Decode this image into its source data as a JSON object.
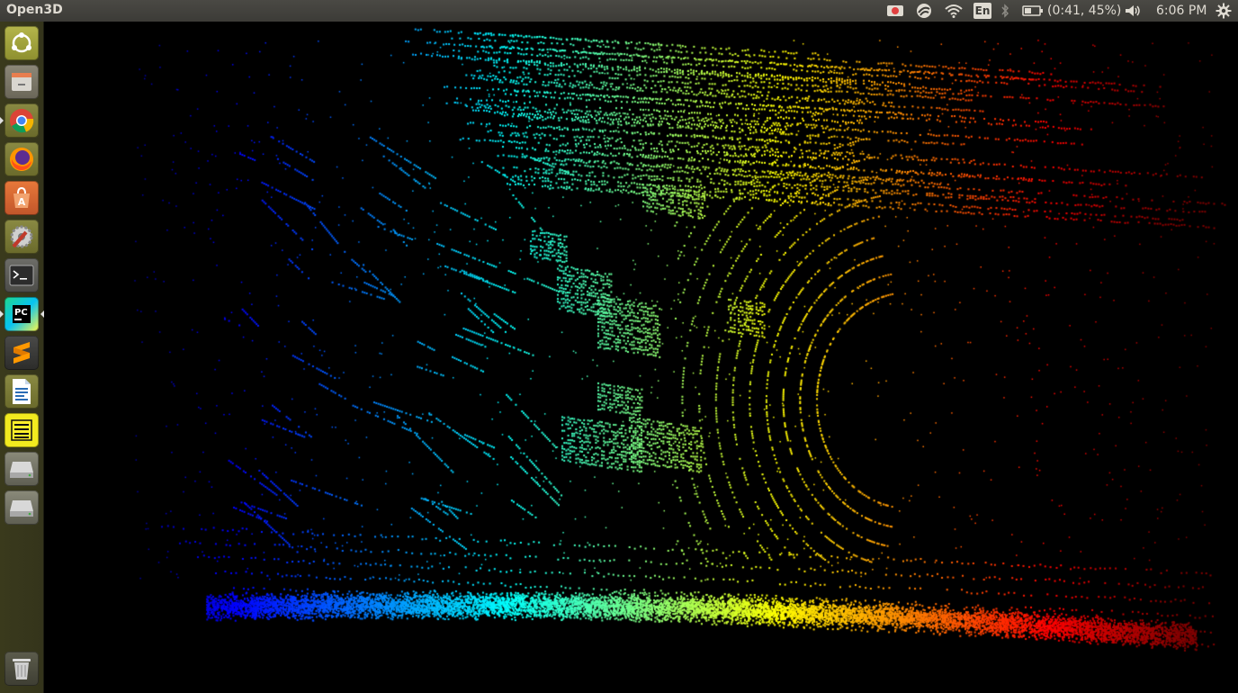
{
  "topbar": {
    "app_title": "Open3D",
    "lang": "En",
    "battery": "(0:41, 45%)",
    "clock": "6:06 PM"
  },
  "launcher": {
    "items": [
      {
        "name": "ubuntu-dash-icon"
      },
      {
        "name": "files-icon"
      },
      {
        "name": "chrome-icon"
      },
      {
        "name": "firefox-icon"
      },
      {
        "name": "software-center-icon"
      },
      {
        "name": "system-settings-icon"
      },
      {
        "name": "terminal-icon"
      },
      {
        "name": "pycharm-icon"
      },
      {
        "name": "sublime-text-icon"
      },
      {
        "name": "libreoffice-writer-icon"
      },
      {
        "name": "notes-icon"
      },
      {
        "name": "drive-icon"
      },
      {
        "name": "drive-icon"
      },
      {
        "name": "trash-icon"
      }
    ]
  },
  "colors": {
    "panel": "#3c3b37",
    "launcher": "#37371c",
    "accent_record": "#e04040"
  }
}
